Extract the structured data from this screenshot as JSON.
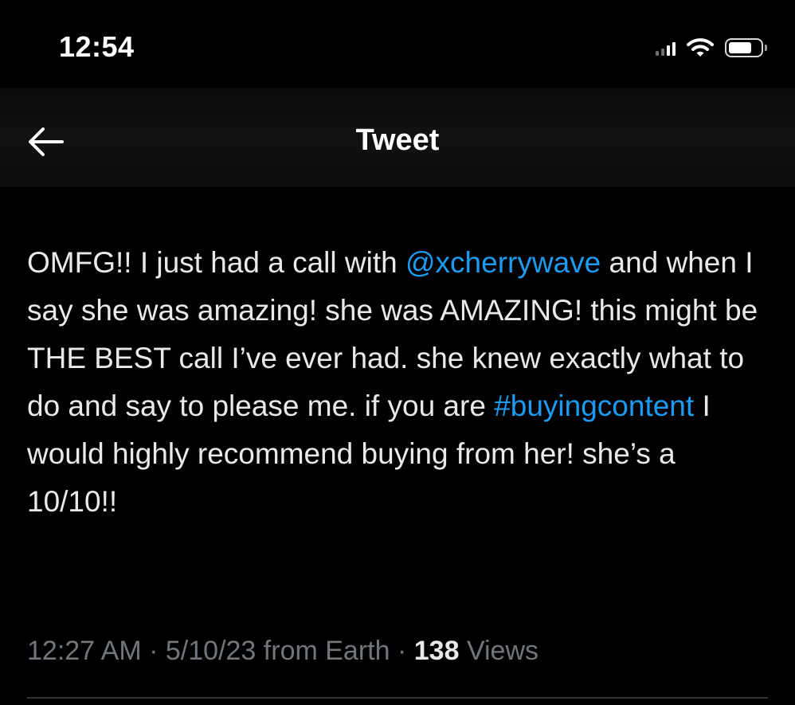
{
  "status_bar": {
    "time": "12:54"
  },
  "nav": {
    "title": "Tweet"
  },
  "tweet": {
    "text_before_mention": "OMFG!! I just had a call with ",
    "mention": "@xcherrywave",
    "text_middle": " and when I say she was amazing! she was AMAZING! this might be THE BEST call I’ve ever had. she knew exactly what to do and say to please me. if you are ",
    "hashtag": "#buyingcontent",
    "text_after_hashtag": " I would highly recommend buying from her! she’s a 10/10!!",
    "time": "12:27 AM",
    "separator": "·",
    "date": "5/10/23",
    "source": "from Earth",
    "views_count": "138",
    "views_label": "Views"
  },
  "colors": {
    "background": "#000000",
    "text": "#e7e9ea",
    "link": "#1d9bf0",
    "muted": "#71767b"
  },
  "icons": {
    "back": "arrow-left-icon",
    "signal": "cellular-signal-icon",
    "wifi": "wifi-icon",
    "battery": "battery-icon"
  }
}
